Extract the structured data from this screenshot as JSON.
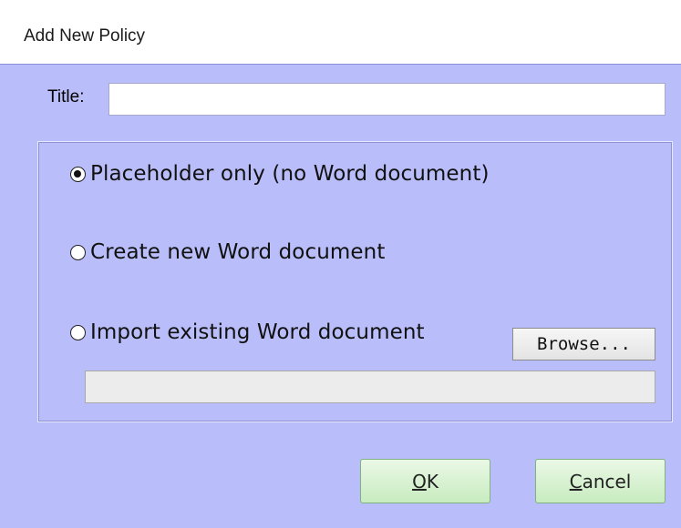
{
  "dialog": {
    "title": "Add New Policy"
  },
  "title_field": {
    "label": "Title:",
    "value": ""
  },
  "options": [
    {
      "label": "Placeholder only (no Word document)",
      "selected": true
    },
    {
      "label": "Create new Word document",
      "selected": false
    },
    {
      "label": "Import existing Word document",
      "selected": false
    }
  ],
  "browse": {
    "label": "Browse..."
  },
  "file_path": {
    "value": ""
  },
  "buttons": {
    "ok_mnemonic": "O",
    "ok_rest": "K",
    "cancel_mnemonic": "C",
    "cancel_rest": "ancel"
  },
  "colors": {
    "dialog_bg": "#b9bdf9",
    "titlebar_bg": "#ffffff",
    "button_green": "#c8ecbf"
  }
}
